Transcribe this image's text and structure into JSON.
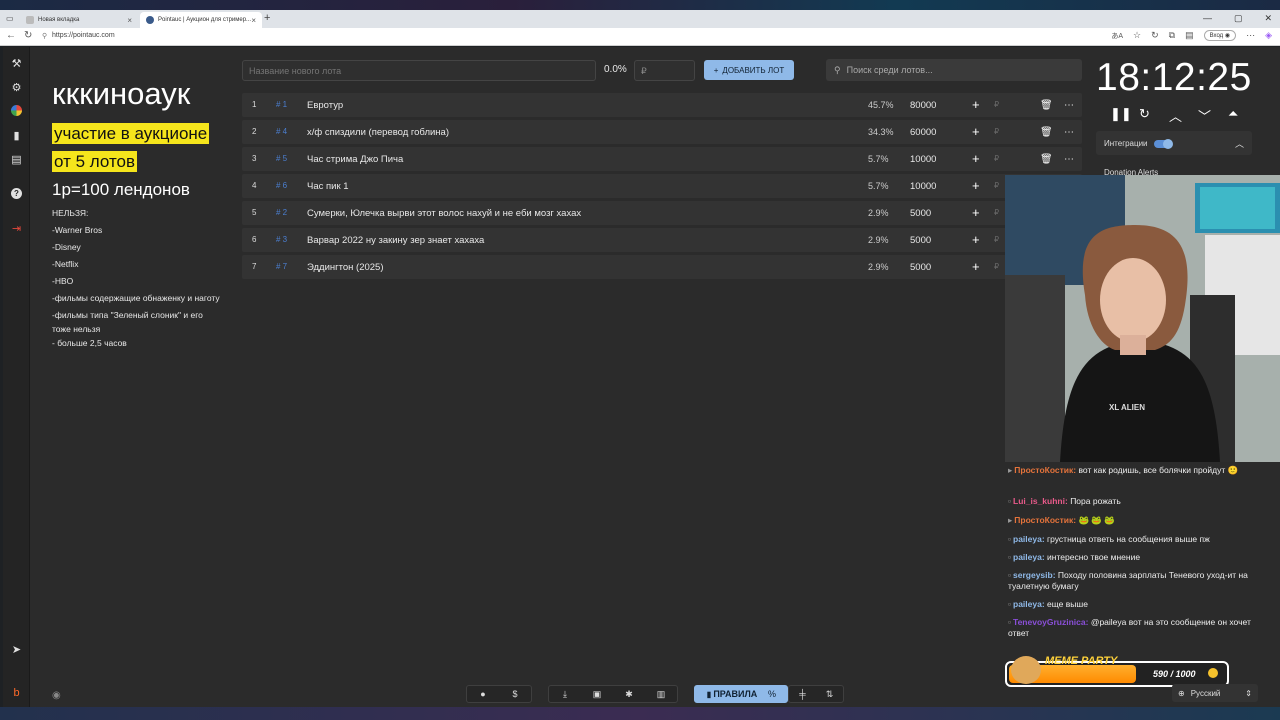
{
  "browser": {
    "tabs": [
      {
        "label": "Новая вкладка",
        "active": false
      },
      {
        "label": "Pointauc | Аукцион для стример...",
        "active": true
      }
    ],
    "url": "https://pointauc.com",
    "login_label": "Вход"
  },
  "rules": {
    "title": "кккиноаук",
    "highlight1": "участие в аукционе",
    "highlight2": "от 5 лотов",
    "rate": "1р=100 лендонов",
    "items": [
      "НЕЛЬЗЯ:",
      "-Warner Bros",
      "-Disney",
      "-Netflix",
      "-HBO",
      "-фильмы содержащие обнаженку и наготу",
      "-фильмы типа \"Зеленый слоник\" и его тоже нельзя",
      "- больше 2,5 часов"
    ]
  },
  "controls": {
    "newlot_placeholder": "Название нового лота",
    "percent": "0.0%",
    "amount_placeholder": "₽",
    "add_label": "ДОБАВИТЬ ЛОТ",
    "search_placeholder": "Поиск среди лотов..."
  },
  "lots": [
    {
      "idx": "1",
      "id": "# 1",
      "name": "Евротур",
      "pct": "45.7%",
      "amount": "80000"
    },
    {
      "idx": "2",
      "id": "# 4",
      "name": "х/ф спиздили (перевод гоблина)",
      "pct": "34.3%",
      "amount": "60000"
    },
    {
      "idx": "3",
      "id": "# 5",
      "name": "Час стрима Джо Пича",
      "pct": "5.7%",
      "amount": "10000"
    },
    {
      "idx": "4",
      "id": "# 6",
      "name": "Час пик 1",
      "pct": "5.7%",
      "amount": "10000"
    },
    {
      "idx": "5",
      "id": "# 2",
      "name": "Сумерки, Юлечка вырви этот волос нахуй и не еби мозг хахах",
      "pct": "2.9%",
      "amount": "5000"
    },
    {
      "idx": "6",
      "id": "# 3",
      "name": "Варвар 2022 ну закину зер знает хахаха",
      "pct": "2.9%",
      "amount": "5000"
    },
    {
      "idx": "7",
      "id": "# 7",
      "name": "Эддингтон (2025)",
      "pct": "2.9%",
      "amount": "5000"
    }
  ],
  "timer": {
    "value": "18:12:25",
    "integrations_label": "Интеграции",
    "donation_label": "Donation Alerts"
  },
  "chat": [
    {
      "nick": "ПростоКостик:",
      "text": "вот как родишь, все болячки пройдут 🙂",
      "color": "#e4733b"
    },
    {
      "nick": "Lui_is_kuhni:",
      "text": "Пора рожать",
      "color": "#e85a8a"
    },
    {
      "nick": "ПростоКостик:",
      "text": "🐸 🐸 🐸",
      "color": "#e4733b"
    },
    {
      "nick": "paileya:",
      "text": "грустница ответь на сообщения выше пж",
      "color": "#8fb9e8"
    },
    {
      "nick": "paileya:",
      "text": "интересно твое мнение",
      "color": "#8fb9e8"
    },
    {
      "nick": "sergeysib:",
      "text": "Походу половина зарплаты Теневого уход-ит на туалетную бумагу",
      "color": "#8fb9e8"
    },
    {
      "nick": "paileya:",
      "text": "еще выше",
      "color": "#8fb9e8"
    },
    {
      "nick": "TenevoyGruzinica:",
      "text": "@paileya вот на это сообщение он хочет ответ",
      "color": "#8a4fd8"
    }
  ],
  "meme": {
    "title": "MEME PARTY",
    "count": "590 / 1000",
    "progress": 0.59
  },
  "bottom": {
    "rules_label": "ПРАВИЛА",
    "language": "Русский"
  },
  "colors": {
    "accent": "#8fb9e8",
    "highlight": "#f5e51c",
    "row_bg": "#333333",
    "id_blue": "#4b7fd1"
  }
}
